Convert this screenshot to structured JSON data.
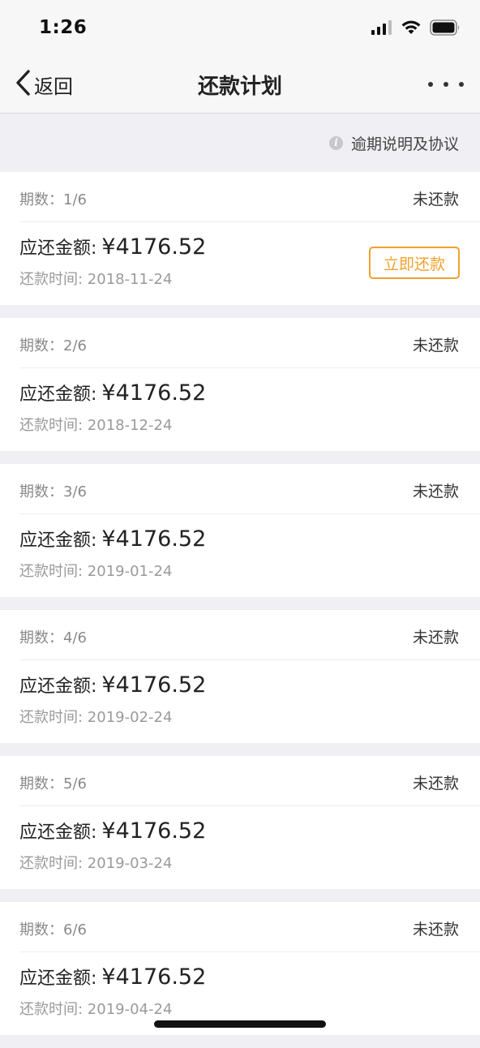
{
  "status_bar": {
    "time": "1:26"
  },
  "nav": {
    "back_label": "返回",
    "title": "还款计划"
  },
  "notice": {
    "label": "逾期说明及协议"
  },
  "labels": {
    "amount_label": "应还金额:",
    "date_label": "还款时间:",
    "pay_button": "立即还款"
  },
  "plans": [
    {
      "period": "期数：1/6",
      "status": "未还款",
      "amount": "¥4176.52",
      "date": "还款时间: 2018-11-24",
      "show_pay_button": true
    },
    {
      "period": "期数：2/6",
      "status": "未还款",
      "amount": "¥4176.52",
      "date": "还款时间: 2018-12-24",
      "show_pay_button": false
    },
    {
      "period": "期数：3/6",
      "status": "未还款",
      "amount": "¥4176.52",
      "date": "还款时间: 2019-01-24",
      "show_pay_button": false
    },
    {
      "period": "期数：4/6",
      "status": "未还款",
      "amount": "¥4176.52",
      "date": "还款时间: 2019-02-24",
      "show_pay_button": false
    },
    {
      "period": "期数：5/6",
      "status": "未还款",
      "amount": "¥4176.52",
      "date": "还款时间: 2019-03-24",
      "show_pay_button": false
    },
    {
      "period": "期数：6/6",
      "status": "未还款",
      "amount": "¥4176.52",
      "date": "还款时间: 2019-04-24",
      "show_pay_button": false
    }
  ],
  "colors": {
    "accent": "#f0a12c",
    "background": "#efeff4"
  },
  "icons": {
    "back": "chevron-left-icon",
    "more": "more-dots-icon",
    "info": "info-icon",
    "signal": "cellular-signal-icon",
    "wifi": "wifi-icon",
    "battery": "battery-icon"
  }
}
